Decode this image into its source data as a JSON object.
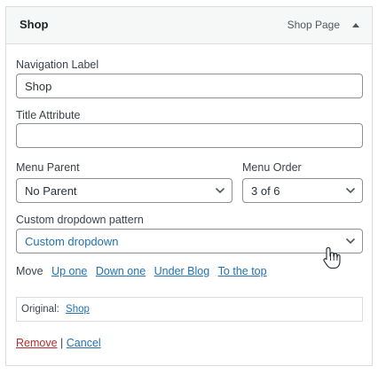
{
  "item": {
    "title": "Shop",
    "type_label": "Shop Page"
  },
  "fields": {
    "nav_label": {
      "label": "Navigation Label",
      "value": "Shop"
    },
    "title_attr": {
      "label": "Title Attribute",
      "value": ""
    },
    "menu_parent": {
      "label": "Menu Parent",
      "value": "No Parent"
    },
    "menu_order": {
      "label": "Menu Order",
      "value": "3 of 6"
    },
    "custom_dropdown": {
      "label": "Custom dropdown pattern",
      "value": "Custom dropdown"
    }
  },
  "move": {
    "label": "Move",
    "links": [
      "Up one",
      "Down one",
      "Under Blog",
      "To the top"
    ]
  },
  "original": {
    "label": "Original:",
    "link": "Shop"
  },
  "actions": {
    "remove": "Remove",
    "separator": "|",
    "cancel": "Cancel"
  },
  "colors": {
    "link": "#2271b1",
    "remove": "#b32d2e",
    "border": "#8c8f94"
  },
  "icons": {
    "toggle": "triangle-up-icon",
    "select_arrow": "chevron-down-icon",
    "cursor": "hand-pointer-cursor"
  }
}
